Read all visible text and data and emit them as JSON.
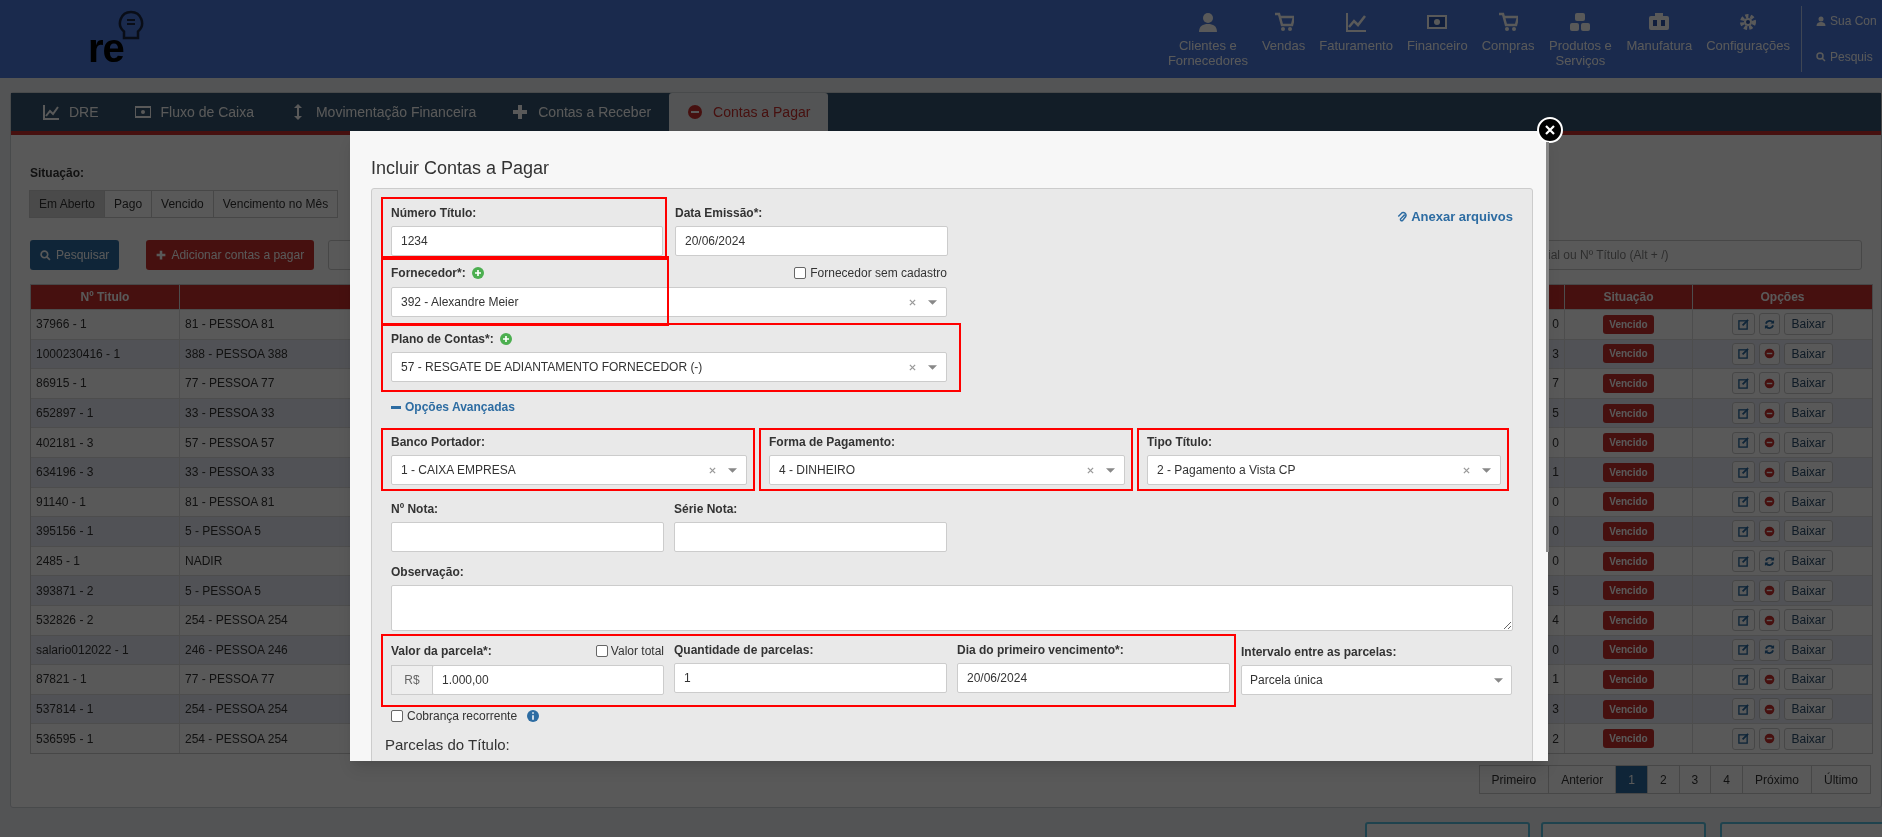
{
  "header": {
    "logo": "re",
    "nav": [
      {
        "label": "Clientes e Fornecedores"
      },
      {
        "label": "Vendas"
      },
      {
        "label": "Faturamento"
      },
      {
        "label": "Financeiro"
      },
      {
        "label": "Compras"
      },
      {
        "label": "Produtos e Serviços"
      },
      {
        "label": "Manufatura"
      },
      {
        "label": "Configurações"
      }
    ],
    "user": "Sua Con",
    "search": "Pesquis"
  },
  "module_tabs": [
    {
      "label": "DRE",
      "selected": false
    },
    {
      "label": "Fluxo de Caixa",
      "selected": false
    },
    {
      "label": "Movimentação Financeira",
      "selected": false
    },
    {
      "label": "Contas a Receber",
      "selected": false
    },
    {
      "label": "Contas a Pagar",
      "selected": true
    }
  ],
  "filter": {
    "label": "Situação:",
    "options": [
      {
        "label": "Em Aberto",
        "selected": true
      },
      {
        "label": "Pago",
        "selected": false
      },
      {
        "label": "Vencido",
        "selected": false
      },
      {
        "label": "Vencimento no Mês",
        "selected": false
      }
    ]
  },
  "actions": {
    "search_button": "Pesquisar",
    "add_button": "Adicionar contas a pagar"
  },
  "search": {
    "placeholder": "ial ou Nº Título (Alt + /)"
  },
  "table": {
    "columns": [
      "Nº Titulo",
      "Situação",
      "Opções"
    ],
    "rows": [
      {
        "titulo": "37966 - 1",
        "pessoa": "81 - PESSOA 81",
        "column_3": "0",
        "status": "Vencido",
        "kind": "refresh",
        "action": "Baixar"
      },
      {
        "titulo": "1000230416 - 1",
        "pessoa": "388 - PESSOA 388",
        "column_3": "3",
        "status": "Vencido",
        "kind": "remove",
        "action": "Baixar"
      },
      {
        "titulo": "86915 - 1",
        "pessoa": "77 - PESSOA 77",
        "column_3": "7",
        "status": "Vencido",
        "kind": "remove",
        "action": "Baixar"
      },
      {
        "titulo": "652897 - 1",
        "pessoa": "33 - PESSOA 33",
        "column_3": "5",
        "status": "Vencido",
        "kind": "remove",
        "action": "Baixar"
      },
      {
        "titulo": "402181 - 3",
        "pessoa": "57 - PESSOA 57",
        "column_3": "0",
        "status": "Vencido",
        "kind": "remove",
        "action": "Baixar"
      },
      {
        "titulo": "634196 - 3",
        "pessoa": "33 - PESSOA 33",
        "column_3": "1",
        "status": "Vencido",
        "kind": "remove",
        "action": "Baixar"
      },
      {
        "titulo": "91140 - 1",
        "pessoa": "81 - PESSOA 81",
        "column_3": "0",
        "status": "Vencido",
        "kind": "remove",
        "action": "Baixar"
      },
      {
        "titulo": "395156 - 1",
        "pessoa": "5 - PESSOA 5",
        "column_3": "0",
        "status": "Vencido",
        "kind": "remove",
        "action": "Baixar"
      },
      {
        "titulo": "2485 - 1",
        "pessoa": "NADIR",
        "column_3": "0",
        "status": "Vencido",
        "kind": "refresh",
        "action": "Baixar"
      },
      {
        "titulo": "393871 - 2",
        "pessoa": "5 - PESSOA 5",
        "column_3": "5",
        "status": "Vencido",
        "kind": "remove",
        "action": "Baixar"
      },
      {
        "titulo": "532826 - 2",
        "pessoa": "254 - PESSOA 254",
        "column_3": "4",
        "status": "Vencido",
        "kind": "remove",
        "action": "Baixar"
      },
      {
        "titulo": "salario012022 - 1",
        "pessoa": "246 - PESSOA 246",
        "column_3": "0",
        "status": "Vencido",
        "kind": "refresh",
        "action": "Baixar"
      },
      {
        "titulo": "87821 - 1",
        "pessoa": "77 - PESSOA 77",
        "column_3": "1",
        "status": "Vencido",
        "kind": "remove",
        "action": "Baixar"
      },
      {
        "titulo": "537814 - 1",
        "pessoa": "254 - PESSOA 254",
        "column_3": "3",
        "status": "Vencido",
        "kind": "remove",
        "action": "Baixar"
      },
      {
        "titulo": "536595 - 1",
        "pessoa": "254 - PESSOA 254",
        "column_3": "2",
        "status": "Vencido",
        "kind": "remove",
        "action": "Baixar"
      }
    ]
  },
  "pagination": [
    {
      "label": "Primeiro",
      "selected": false
    },
    {
      "label": "Anterior",
      "selected": false
    },
    {
      "label": "1",
      "selected": true
    },
    {
      "label": "2",
      "selected": false
    },
    {
      "label": "3",
      "selected": false
    },
    {
      "label": "4",
      "selected": false
    },
    {
      "label": "Próximo",
      "selected": false
    },
    {
      "label": "Último",
      "selected": false
    }
  ],
  "modal": {
    "title": "Incluir Contas a Pagar",
    "attach_link": "Anexar arquivos",
    "numero_titulo": {
      "label": "Número Título:",
      "value": "1234",
      "highlighted": true
    },
    "data_emissao": {
      "label": "Data Emissão*:",
      "value": "20/06/2024"
    },
    "fornecedor": {
      "label": "Fornecedor*:",
      "value": "392 - Alexandre Meier",
      "highlighted": true,
      "no_register": {
        "label": "Fornecedor sem cadastro",
        "checked": false
      }
    },
    "plano_contas": {
      "label": "Plano de Contas*:",
      "value": "57 - RESGATE DE ADIANTAMENTO FORNECEDOR (-)",
      "highlighted": true
    },
    "advanced_link": "Opções Avançadas",
    "selects": [
      {
        "label": "Banco Portador:",
        "value": "1 - CAIXA EMPRESA",
        "highlighted": true
      },
      {
        "label": "Forma de Pagamento:",
        "value": "4 - DINHEIRO",
        "highlighted": true
      },
      {
        "label": "Tipo Título:",
        "value": "2 - Pagamento a Vista CP",
        "highlighted": true
      }
    ],
    "nota": {
      "label": "Nº Nota:"
    },
    "serie": {
      "label": "Série Nota:"
    },
    "observacao": {
      "label": "Observação:"
    },
    "parcela_group": {
      "highlighted": true,
      "valor": {
        "label": "Valor da parcela*:",
        "prefix": "R$",
        "value": "1.000,00",
        "total": {
          "label": "Valor total",
          "checked": false
        }
      },
      "quantidade": {
        "label": "Quantidade de parcelas:",
        "value": "1"
      },
      "vencimento": {
        "label": "Dia do primeiro vencimento*:",
        "value": "20/06/2024"
      }
    },
    "intervalo": {
      "label": "Intervalo entre as parcelas:",
      "value": "Parcela única"
    },
    "recorrente": {
      "label": "Cobrança recorrente",
      "checked": false
    },
    "parcelas_heading": "Parcelas do Título:"
  }
}
